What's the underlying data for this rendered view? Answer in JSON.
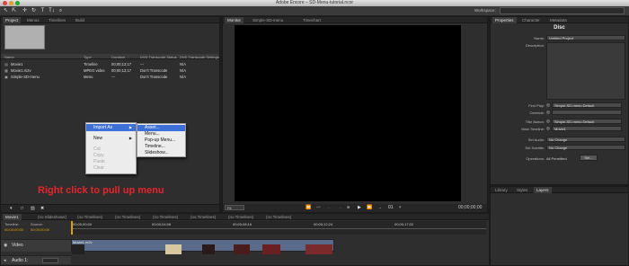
{
  "app": {
    "title": "Adobe Encore – SD-Menu-tutorial.ncor"
  },
  "toolbar": {
    "workspace_label": "Workspace:"
  },
  "project_panel": {
    "tabs": [
      "Project",
      "Menus",
      "Timelines",
      "Build"
    ],
    "columns": [
      "Name",
      "Type",
      "Duration",
      "DVD Transcode Status",
      "DVD Transcode Settings"
    ],
    "rows": [
      {
        "name": "Movie1",
        "type": "Timeline",
        "duration": "00;00;12;17",
        "status": "---",
        "settings": "N/A"
      },
      {
        "name": "Movie1.m2v",
        "type": "MPEG video",
        "duration": "00;00;12;17",
        "status": "Don't Transcode",
        "settings": "N/A"
      },
      {
        "name": "Simple-SD-menu",
        "type": "Menu",
        "duration": "---",
        "status": "Don't Transcode",
        "settings": "N/A"
      }
    ]
  },
  "context_menu": {
    "items": [
      {
        "label": "Import As",
        "state": "highlighted",
        "submenu": true
      },
      {
        "label": "New",
        "state": "normal",
        "submenu": true
      },
      {
        "label": "Cut",
        "state": "disabled"
      },
      {
        "label": "Copy",
        "state": "disabled"
      },
      {
        "label": "Paste",
        "state": "disabled"
      },
      {
        "label": "Clear",
        "state": "disabled"
      }
    ],
    "submenu_items": [
      "Asset...",
      "Menu...",
      "Pop-up Menu...",
      "Timeline...",
      "Slideshow..."
    ]
  },
  "annotation": "Right click to pull up menu",
  "monitor": {
    "tabs": [
      "Monitor",
      "Simple-SD-menu",
      "Timechart"
    ],
    "zoom": "Fit",
    "page": "01",
    "timecode": "00;00;00;00"
  },
  "properties": {
    "tabs": [
      "Properties",
      "Character",
      "Metadata"
    ],
    "heading": "Disc",
    "name_label": "Name:",
    "name_value": "Untitled Project",
    "description_label": "Description:",
    "first_play_label": "First Play:",
    "first_play_value": "Simple-SD-menu:Default",
    "override_label": "Override:",
    "title_button_label": "Title Button:",
    "title_button_value": "Simple-SD-menu:Default",
    "main_timeline_label": "Main Timeline:",
    "main_timeline_value": "Movie1",
    "set_audio_label": "Set Audio:",
    "set_audio_value": "No Change",
    "set_subtitle_label": "Set Subtitle:",
    "set_subtitle_value": "No Change",
    "operations_label": "Operations:",
    "operations_value": "All Permitted",
    "set_button": "Set..."
  },
  "bottom_right_tabs": [
    "Library",
    "Styles",
    "Layers"
  ],
  "timeline": {
    "tabs": [
      "Movie1",
      "(no Slideshows)",
      "(no Timelines)",
      "(no Timelines)",
      "(no Timelines)",
      "(no Timelines)",
      "(no Timelines)",
      "(no Timelines)"
    ],
    "timeline_label": "Timeline:",
    "source_label": "Source:",
    "timecode": "00;00;00;00",
    "source_timecode": "00;00;00;00",
    "ruler": [
      "00;00;00;00",
      "00;00;04;08",
      "00;00;08;16",
      "00;00;12;24",
      "00;00;17;02"
    ],
    "video_track": "Video",
    "clip_name": "Movie1.m2v",
    "audio_track": "Audio 1:"
  },
  "colors": {
    "highlight": "#3d6fd9",
    "annotation": "#e8242b",
    "timecode": "#e0a000"
  }
}
